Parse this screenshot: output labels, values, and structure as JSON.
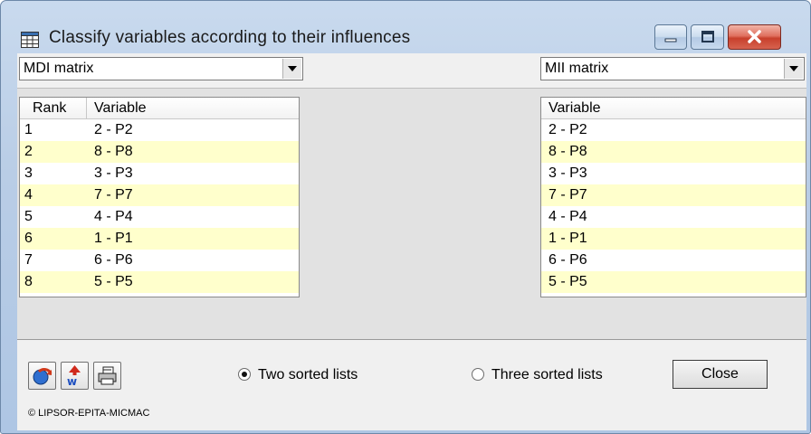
{
  "window": {
    "title": "Classify variables according to their influences"
  },
  "left_panel": {
    "combo_value": "MDI matrix",
    "header_rank": "Rank",
    "header_variable": "Variable",
    "rows": [
      {
        "rank": "1",
        "variable": "2 - P2"
      },
      {
        "rank": "2",
        "variable": "8 - P8"
      },
      {
        "rank": "3",
        "variable": "3 - P3"
      },
      {
        "rank": "4",
        "variable": "7 - P7"
      },
      {
        "rank": "5",
        "variable": "4 - P4"
      },
      {
        "rank": "6",
        "variable": "1 - P1"
      },
      {
        "rank": "7",
        "variable": "6 - P6"
      },
      {
        "rank": "8",
        "variable": "5 - P5"
      }
    ]
  },
  "right_panel": {
    "combo_value": "MII matrix",
    "header_variable": "Variable",
    "rows": [
      {
        "variable": "2 - P2"
      },
      {
        "variable": "8 - P8"
      },
      {
        "variable": "3 - P3"
      },
      {
        "variable": "7 - P7"
      },
      {
        "variable": "4 - P4"
      },
      {
        "variable": "1 - P1"
      },
      {
        "variable": "6 - P6"
      },
      {
        "variable": "5 - P5"
      }
    ]
  },
  "toolbar": {
    "icons": [
      "refresh-icon",
      "weighted-sort-icon",
      "print-icon"
    ]
  },
  "options": {
    "two_lists_label": "Two sorted lists",
    "three_lists_label": "Three sorted lists",
    "selected": "Two sorted lists"
  },
  "buttons": {
    "close_label": "Close"
  },
  "footer": {
    "copyright": "© LIPSOR-EPITA-MICMAC"
  },
  "colors": {
    "row_highlight": "#ffffcc",
    "title_close": "#c8402c"
  }
}
